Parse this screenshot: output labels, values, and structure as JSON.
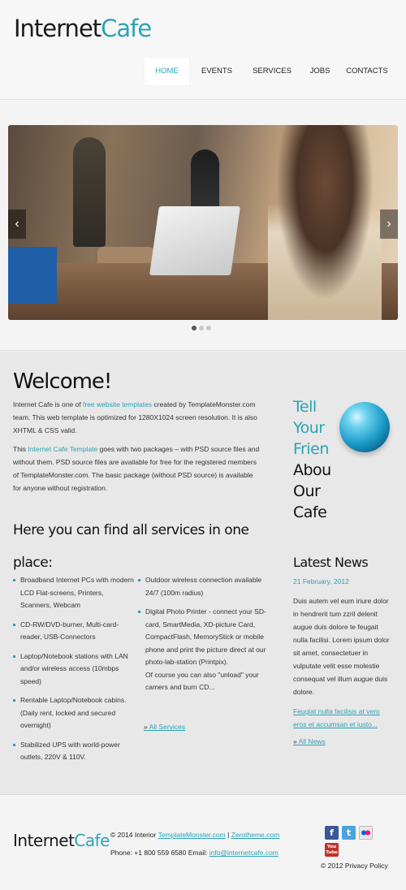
{
  "header": {
    "logo_part1": "Internet",
    "logo_part2": "Cafe",
    "nav": [
      "HOME",
      "EVENTS",
      "SERVICES",
      "JOBS",
      "CONTACTS"
    ]
  },
  "slider": {
    "prev_label": "‹",
    "next_label": "›",
    "dot_count": 3,
    "active_dot": 0
  },
  "welcome": {
    "title": "Welcome!",
    "p1_a": "Internet Cafe is one of ",
    "p1_link": "free website templates",
    "p1_b": " created by TemplateMonster.com team. This web template is optimized for 1280X1024 screen resolution. It is also XHTML & CSS valid.",
    "p2_a": "This ",
    "p2_link": "Internet Cafe Template",
    "p2_b": " goes with two packages – with PSD source files and without them. PSD source files are available for free for the registered members of TemplateMonster.com. The basic package (without PSD source) is available for anyone without registration."
  },
  "services": {
    "title": "Here you can find all services in one place:",
    "left_items": [
      "Broadband Internet PCs with modern LCD Flat-screens, Printers, Scanners, Webcam",
      "CD-RW/DVD-burner, Multi-card-reader, USB-Connectors",
      "Laptop/Notebook stations with LAN and/or wireless access (10mbps speed)",
      "Rentable Laptop/Notebook cabins. (Daily rent, locked and secured overnight)",
      "Stabilized UPS with world-power outlets, 220V & 110V."
    ],
    "right_items": [
      "Outdoor wireless connection available 24/7 (100m radius)",
      "Digital Photo Printer - connect your SD-card, SmartMedia, XD-picture Card, CompactFlash, MemoryStick or mobile phone and print the picture direct at our photo-lab-station (Printpix).\nOf course you can also \"unload\" your camers and burn CD..."
    ],
    "more_bullet": "» ",
    "more_label": "All Services"
  },
  "tell": {
    "l1": "Tell",
    "l2": "Your",
    "l3": "Frien",
    "l4": "Abou",
    "l5": "Our",
    "l6": "Cafe"
  },
  "news": {
    "title": "Latest News",
    "date": "21 February, 2012",
    "text": "Duis autem vel eum iriure dolor in hendrerit tum zzril delenit augue duis dolore te feugait nulla facilisi. Lorem ipsum dolor sit amet, consectetuer in vulputate velit esse molestie consequat vel illum augue duis dolore.",
    "link_text": "Feugiat nulla facilisis at vero eros et accumsan et iusto...",
    "more_bullet": "» ",
    "more_label": "All News"
  },
  "footer": {
    "logo_part1": "Internet",
    "logo_part2": "Cafe",
    "copy_a": "© 2014 Interior ",
    "copy_link1": "TemplateMonster.com",
    "copy_sep": " | ",
    "copy_link2": "Zerotheme.com",
    "phone_a": "Phone: +1 800 559 6580 Email: ",
    "phone_link": "info@internetcafe.com",
    "privacy": "© 2012 Privacy Policy",
    "social": [
      {
        "icon": "facebook-icon",
        "glyph": "f"
      },
      {
        "icon": "twitter-icon",
        "glyph": "t"
      },
      {
        "icon": "flickr-icon",
        "glyph": ""
      },
      {
        "icon": "youtube-icon",
        "glyph": "You Tube"
      }
    ]
  },
  "colors": {
    "accent": "#2aa3b5",
    "background": "#e8e8e8"
  }
}
